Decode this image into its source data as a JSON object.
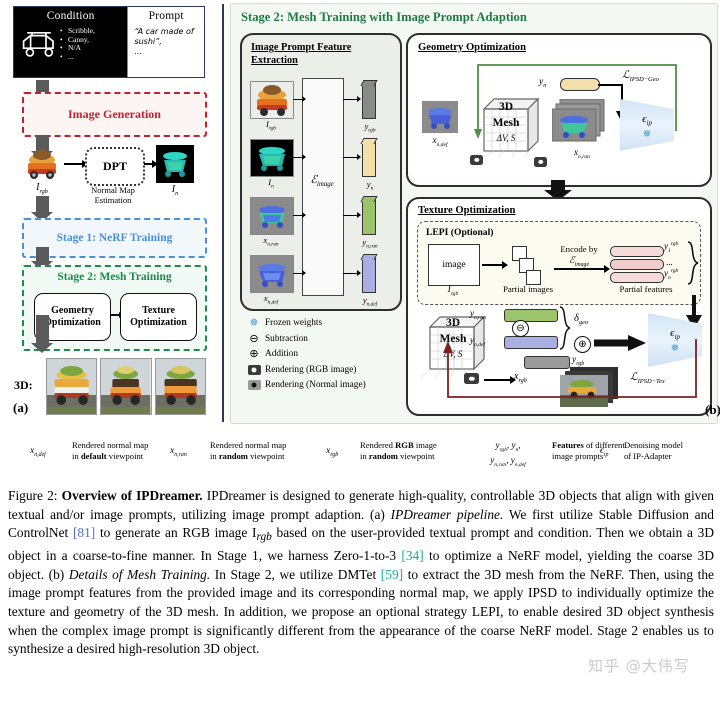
{
  "panel_a": {
    "label": "(a)",
    "condition_box": {
      "condition_header": "Condition",
      "prompt_header": "Prompt",
      "condition_items": [
        "Scribble,",
        "Canny,",
        "N/A",
        "..."
      ],
      "prompt_text": "“A car made of sushi”,",
      "prompt_ellipsis": "...",
      "car_icon": "scribble-car-icon"
    },
    "image_generation": "Image Generation",
    "dpt": {
      "box_label": "DPT",
      "caption": "Normal Map Estimation",
      "input_label": "I_rgb",
      "output_label": "I_n"
    },
    "stage1": "Stage 1: NeRF Training",
    "stage2": {
      "title": "Stage 2: Mesh Training",
      "geometry": "Geometry Optimization",
      "texture": "Texture Optimization"
    },
    "result_label": "3D:"
  },
  "panel_b": {
    "label": "(b)",
    "header": "Stage 2: Mesh Training with Image Prompt Adaption",
    "ipfe": {
      "title_line1": "Image Prompt Feature",
      "title_line2": "Extraction",
      "encoder_label": "E_image",
      "inputs": [
        {
          "label": "I_rgb",
          "kind": "rgb-car-image"
        },
        {
          "label": "I_n",
          "kind": "normal-map-black-bg"
        },
        {
          "label": "x_n,ran",
          "kind": "normal-render-grey-bg"
        },
        {
          "label": "x_n,def",
          "kind": "normal-render-grey-bg"
        }
      ],
      "outputs": [
        {
          "label": "y_rgb",
          "color": "#8a8a8a"
        },
        {
          "label": "y_n",
          "color": "#f2e0ab"
        },
        {
          "label": "y_n,ran",
          "color": "#9cc46a"
        },
        {
          "label": "y_n,def",
          "color": "#a7b0e0"
        }
      ]
    },
    "legend": [
      {
        "icon": "snowflake-icon",
        "glyph": "❅",
        "text": "Frozen weights"
      },
      {
        "icon": "minus-circle-icon",
        "glyph": "⊖",
        "text": "Subtraction"
      },
      {
        "icon": "plus-circle-icon",
        "glyph": "⊕",
        "text": "Addition"
      },
      {
        "icon": "camera-rgb-icon",
        "glyph": "",
        "text": "Rendering (RGB image)"
      },
      {
        "icon": "camera-normal-icon",
        "glyph": "",
        "text": "Rendering (Normal image)"
      }
    ],
    "geometry_optimization": {
      "title": "Geometry Optimization",
      "input_image_label": "x_n,def",
      "mesh_label_1": "3D",
      "mesh_label_2": "Mesh",
      "mesh_params": "ΔV, S",
      "feature_label": "y_n",
      "render_label": "x_n,ran",
      "denoiser_label": "ϵ_ip",
      "loss_label": "L_IPSD−Geo"
    },
    "texture_optimization": {
      "title": "Texture Optimization",
      "lepi": {
        "title": "LEPI (Optional)",
        "image_box_label": "image",
        "image_sub_label": "I_rgb",
        "partial_images": "Partial images",
        "encode_by": "Encode by",
        "encoder": "E_image",
        "partial_features": "Partial features",
        "feature_first": "y_1^rgb",
        "feature_dots": "...",
        "feature_last": "y_n^rgb"
      },
      "mesh_label_1": "3D",
      "mesh_label_2": "Mesh",
      "mesh_params": "ΔV, S",
      "bar_ran": "y_n,ran",
      "bar_def": "y_n,def",
      "delta_geo": "δ_geo",
      "bar_rgb": "y_rgb",
      "render_label": "x_rgb",
      "denoiser_label": "ϵ_ip",
      "loss_label": "L_IPSD−Tex",
      "minus_glyph": "⊖",
      "plus_glyph": "⊕"
    }
  },
  "notation": [
    {
      "symbol": "x_n,def",
      "line1_pre": "Rendered normal map",
      "line2_pre": "in ",
      "line2_bold": "default",
      "line2_post": " viewpoint"
    },
    {
      "symbol": "x_n,ran",
      "line1_pre": "Rendered normal map",
      "line2_pre": "in ",
      "line2_bold": "random",
      "line2_post": " viewpoint"
    },
    {
      "symbol": "x_rgb",
      "line1_pre": "Rendered ",
      "line1_bold": "RGB",
      "line1_post": " image",
      "line2_pre": "in ",
      "line2_bold": "random",
      "line2_post": " viewpoint"
    },
    {
      "symbol": "y_rgb, y_n,",
      "symbol2": "y_n,ran, y_n,def",
      "line1_bold": "Features",
      "line1_post": " of different",
      "line2": "image prompts"
    },
    {
      "symbol": "ϵ_ip",
      "line1": "Denoising model",
      "line2": "of IP-Adapter"
    }
  ],
  "caption": {
    "figure_no": "Figure 2:",
    "title": "Overview of IPDreamer.",
    "body_1": " IPDreamer is designed to generate high-quality, controllable 3D objects that align with given textual and/or image prompts, utilizing image prompt adaption. (a) ",
    "italic_1": "IPDreamer pipeline.",
    "body_2": " We first utilize Stable Diffusion and ControlNet ",
    "ref_1": "81",
    "body_3": " to generate an RGB image I",
    "sub_1": "rgb",
    "body_4": " based on the user-provided textual prompt and condition. Then we obtain a 3D object in a coarse-to-fine manner. In Stage 1, we harness Zero-1-to-3 ",
    "ref_2": "34",
    "body_5": " to optimize a NeRF model, yielding the coarse 3D object. (b) ",
    "italic_2": "Details of Mesh Training.",
    "body_6": " In Stage 2, we utilize DMTet ",
    "ref_3": "59",
    "body_7": " to extract the 3D mesh from the NeRF. Then, using the image prompt features from the provided image and its corresponding normal map, we apply IPSD to individually optimize the texture and geometry of the 3D mesh. In addition, we propose an optional strategy LEPI, to enable desired 3D object synthesis when the complex image prompt is significantly different from the appearance of the coarse NeRF model. Stage 2 enables us to synthesize a desired high-resolution 3D object."
  },
  "watermark": "知乎 @大伟写",
  "colors": {
    "stage1_blue": "#4a90d9",
    "stage2_green": "#1e8a4c",
    "imagegen_red": "#c2202e",
    "panel_b_bg": "#f4f8f2",
    "header_green": "#1e7a45"
  }
}
